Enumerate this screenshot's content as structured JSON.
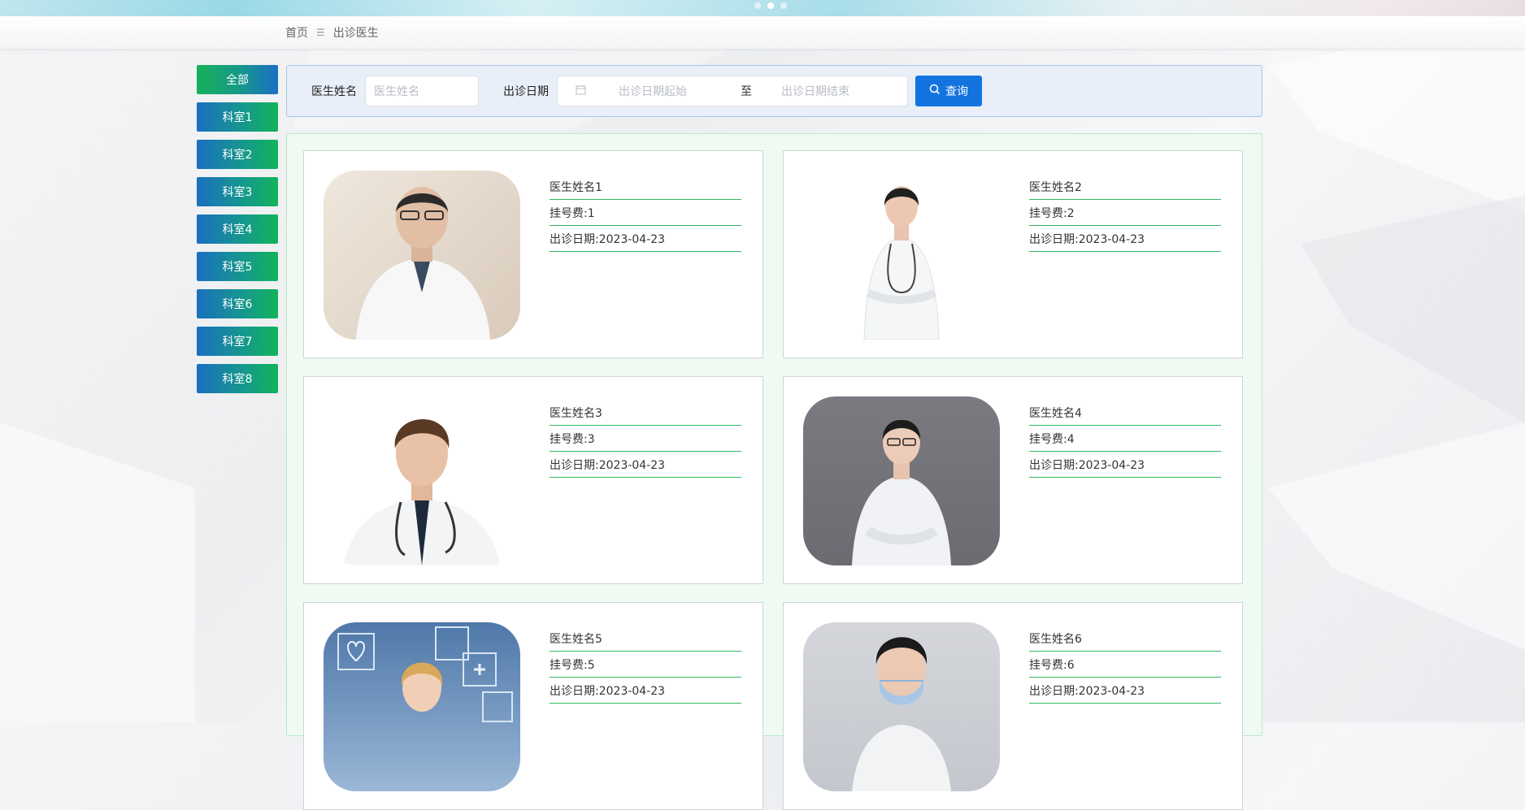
{
  "breadcrumb": {
    "home": "首页",
    "separator": "☰",
    "current": "出诊医生"
  },
  "sidebar": {
    "items": [
      {
        "label": "全部",
        "active": true
      },
      {
        "label": "科室1"
      },
      {
        "label": "科室2"
      },
      {
        "label": "科室3"
      },
      {
        "label": "科室4"
      },
      {
        "label": "科室5"
      },
      {
        "label": "科室6"
      },
      {
        "label": "科室7"
      },
      {
        "label": "科室8"
      }
    ]
  },
  "search": {
    "name_label": "医生姓名",
    "name_placeholder": "医生姓名",
    "date_label": "出诊日期",
    "date_start_placeholder": "出诊日期起始",
    "date_to": "至",
    "date_end_placeholder": "出诊日期结束",
    "query_button": "查询"
  },
  "doctors": [
    {
      "name": "医生姓名1",
      "fee": "挂号费:1",
      "date": "出诊日期:2023-04-23"
    },
    {
      "name": "医生姓名2",
      "fee": "挂号费:2",
      "date": "出诊日期:2023-04-23"
    },
    {
      "name": "医生姓名3",
      "fee": "挂号费:3",
      "date": "出诊日期:2023-04-23"
    },
    {
      "name": "医生姓名4",
      "fee": "挂号费:4",
      "date": "出诊日期:2023-04-23"
    },
    {
      "name": "医生姓名5",
      "fee": "挂号费:5",
      "date": "出诊日期:2023-04-23"
    },
    {
      "name": "医生姓名6",
      "fee": "挂号费:6",
      "date": "出诊日期:2023-04-23"
    }
  ],
  "colors": {
    "accent_blue": "#1474df",
    "line_green": "#2fbd5e",
    "panel_green": "#eefaf2",
    "panel_blue": "#e8eff9"
  }
}
